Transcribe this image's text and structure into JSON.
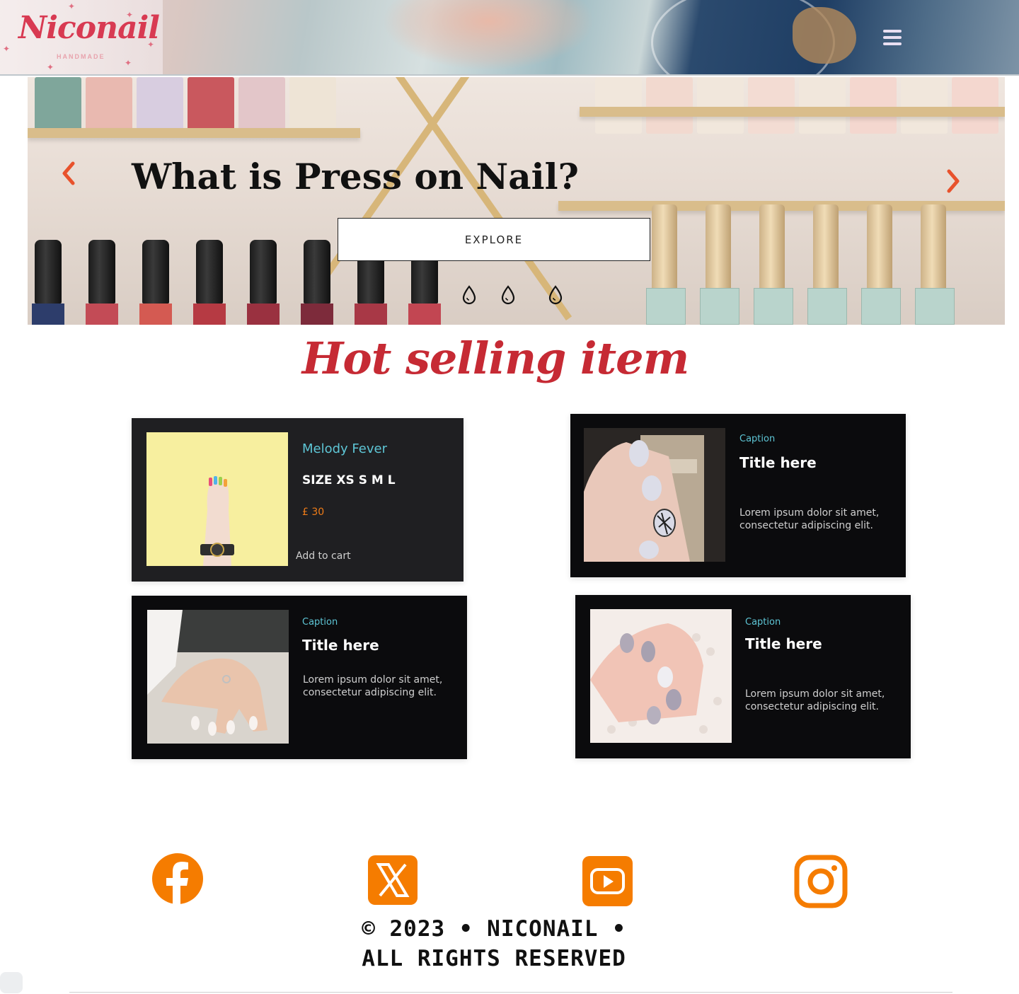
{
  "header": {
    "logo_text": "Niconail",
    "logo_subtext": "HANDMADE",
    "menu_icon": "hamburger-menu-icon"
  },
  "hero": {
    "title": "What is Press on Nail?",
    "button_label": "EXPLORE",
    "prev_icon": "chevron-left-icon",
    "next_icon": "chevron-right-icon",
    "dots": 3,
    "accent_color": "#e8522c"
  },
  "section": {
    "title": "Hot selling item",
    "title_color": "#c62a34"
  },
  "cards": [
    {
      "name": "Melody Fever",
      "size": "SIZE XS S M L",
      "price": "£ 30",
      "cta": "Add to cart"
    },
    {
      "caption": "Caption",
      "title": "Title here",
      "body": "Lorem ipsum dolor sit amet, consectetur adipiscing elit."
    },
    {
      "caption": "Caption",
      "title": "Title here",
      "body": "Lorem ipsum dolor sit amet, consectetur adipiscing elit."
    },
    {
      "caption": "Caption",
      "title": "Title here",
      "body": "Lorem ipsum dolor sit amet, consectetur adipiscing elit."
    }
  ],
  "social": {
    "icons": [
      "facebook-icon",
      "x-twitter-icon",
      "youtube-icon",
      "instagram-icon"
    ],
    "color": "#f57c00"
  },
  "footer": {
    "line1": "© 2023 • NICONAIL •",
    "line2": "ALL RIGHTS RESERVED"
  }
}
